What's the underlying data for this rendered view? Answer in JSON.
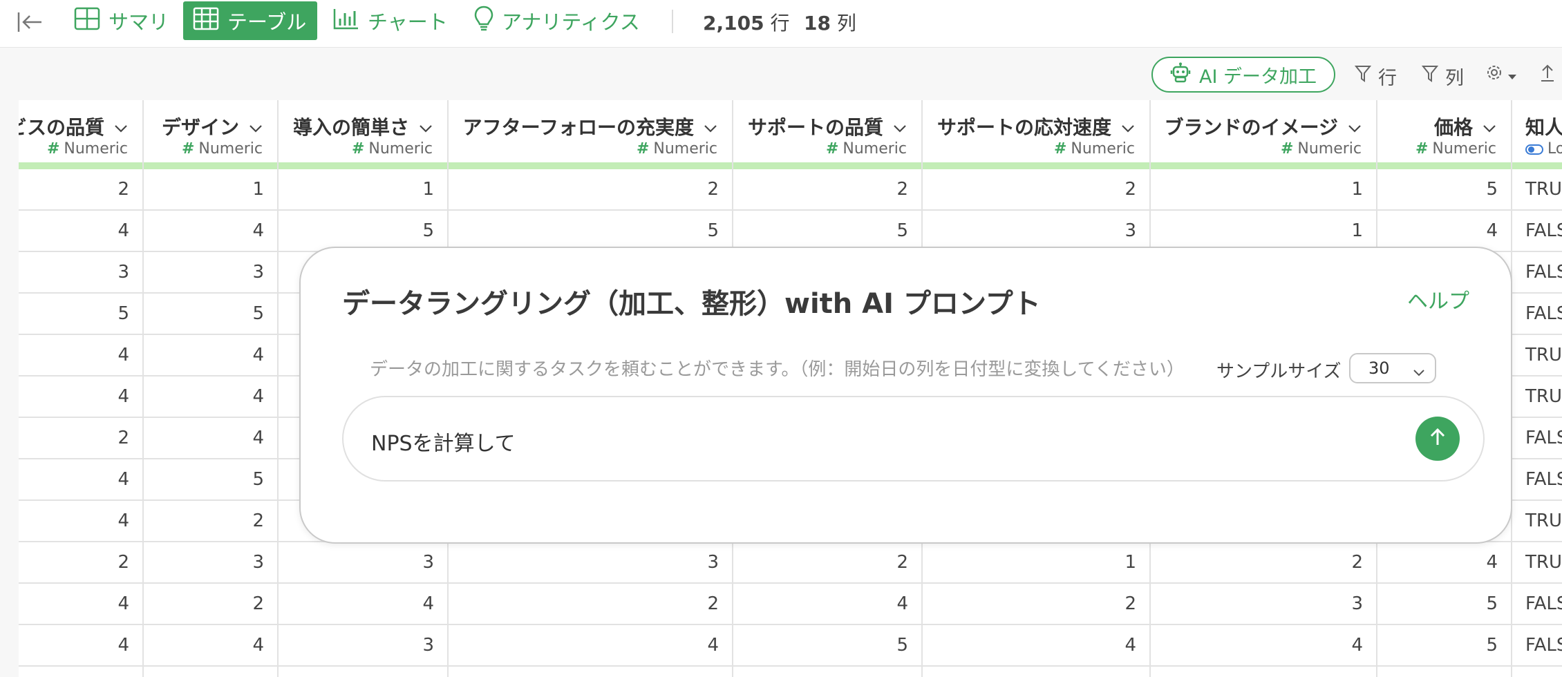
{
  "nav": {
    "tabs": [
      {
        "label": "サマリ",
        "icon": "summary-grid-icon",
        "active": false
      },
      {
        "label": "テーブル",
        "icon": "table-icon",
        "active": true
      },
      {
        "label": "チャート",
        "icon": "bar-chart-icon",
        "active": false
      },
      {
        "label": "アナリティクス",
        "icon": "lightbulb-icon",
        "active": false
      }
    ],
    "rows_count": "2,105",
    "rows_unit": "行",
    "cols_count": "18",
    "cols_unit": "列"
  },
  "toolbar": {
    "ai_button_label": "AI データ加工",
    "filter_rows_label": "行",
    "filter_cols_label": "列"
  },
  "table": {
    "columns": [
      {
        "name": "ビスの品質",
        "type": "Numeric"
      },
      {
        "name": "デザイン",
        "type": "Numeric"
      },
      {
        "name": "導入の簡単さ",
        "type": "Numeric"
      },
      {
        "name": "アフターフォローの充実度",
        "type": "Numeric"
      },
      {
        "name": "サポートの品質",
        "type": "Numeric"
      },
      {
        "name": "サポートの応対速度",
        "type": "Numeric"
      },
      {
        "name": "ブランドのイメージ",
        "type": "Numeric"
      },
      {
        "name": "価格",
        "type": "Numeric"
      },
      {
        "name": "知人",
        "type": "Lo"
      }
    ],
    "rows": [
      [
        "2",
        "1",
        "1",
        "2",
        "2",
        "2",
        "1",
        "5",
        "TRU"
      ],
      [
        "4",
        "4",
        "5",
        "5",
        "5",
        "3",
        "1",
        "4",
        "FALS"
      ],
      [
        "3",
        "3",
        "",
        "",
        "",
        "",
        "",
        "",
        "FALS"
      ],
      [
        "5",
        "5",
        "",
        "",
        "",
        "",
        "",
        "",
        "FALS"
      ],
      [
        "4",
        "4",
        "",
        "",
        "",
        "",
        "",
        "",
        "TRU"
      ],
      [
        "4",
        "4",
        "",
        "",
        "",
        "",
        "",
        "",
        "TRU"
      ],
      [
        "2",
        "4",
        "",
        "",
        "",
        "",
        "",
        "",
        "FALS"
      ],
      [
        "4",
        "5",
        "",
        "",
        "",
        "",
        "",
        "",
        "FALS"
      ],
      [
        "4",
        "2",
        "",
        "",
        "",
        "",
        "",
        "",
        "TRU"
      ],
      [
        "2",
        "3",
        "3",
        "3",
        "2",
        "1",
        "2",
        "4",
        "TRU"
      ],
      [
        "4",
        "2",
        "4",
        "2",
        "4",
        "2",
        "3",
        "5",
        "FALS"
      ],
      [
        "4",
        "4",
        "3",
        "4",
        "5",
        "4",
        "4",
        "5",
        "FALS"
      ]
    ]
  },
  "modal": {
    "title": "データラングリング（加工、整形）with AI プロンプト",
    "help_label": "ヘルプ",
    "hint": "データの加工に関するタスクを頼むことができます。（例：開始日の列を日付型に変換してください）",
    "sample_size_label": "サンプルサイズ",
    "sample_size_value": "30",
    "prompt_value": "NPSを計算して"
  },
  "colors": {
    "accent": "#3ea55f",
    "header_strip": "#c3edb6"
  }
}
